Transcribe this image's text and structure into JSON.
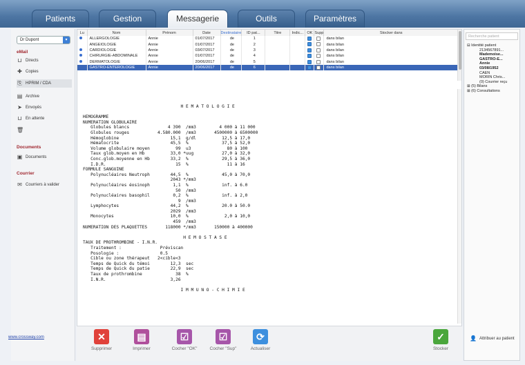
{
  "tabs": [
    "Patients",
    "Gestion",
    "Messagerie",
    "Outils",
    "Paramètres"
  ],
  "sidebar": {
    "doctor": "Dr Dupont",
    "email_section": "eMail",
    "items": [
      {
        "label": "Directs",
        "icon": "inbox-icon"
      },
      {
        "label": "Copies",
        "icon": "plus-icon"
      },
      {
        "label": "HPRIM / CDA",
        "icon": "document-icon"
      },
      {
        "label": "Archive",
        "icon": "archive-icon"
      },
      {
        "label": "Envoyés",
        "icon": "send-icon"
      },
      {
        "label": "En attente",
        "icon": "outbox-icon"
      },
      {
        "label": "",
        "icon": "trash-icon"
      }
    ],
    "documents_section": "Documents",
    "documents_item": "Documents",
    "courrier_section": "Courrier",
    "courrier_item": "Courriers à valider",
    "website": "www.crossway.com"
  },
  "table": {
    "headers": [
      "Lu",
      "Nom",
      "Prénom",
      "Date",
      "Destinataire",
      "ID pat...",
      "Titre",
      "Indic...",
      "OK",
      "Supp",
      "Stocker dans"
    ],
    "rows": [
      {
        "nom": "ALLERGOLOGIE",
        "prenom": "Annie",
        "date": "01/07/2017",
        "dest": "de",
        "id": "1",
        "ok": true,
        "supp": false,
        "stock": "dans bilan",
        "dot": true
      },
      {
        "nom": "ANGEIOLOGIE",
        "prenom": "Annie",
        "date": "01/07/2017",
        "dest": "de",
        "id": "2",
        "ok": true,
        "supp": false,
        "stock": "dans bilan",
        "dot": false
      },
      {
        "nom": "CARDIOLOGIE",
        "prenom": "Annie",
        "date": "03/07/2017",
        "dest": "de",
        "id": "3",
        "ok": true,
        "supp": false,
        "stock": "dans bilan",
        "dot": true
      },
      {
        "nom": "CHIRURGIE-ABDOMINALE",
        "prenom": "Annie",
        "date": "01/07/2017",
        "dest": "de",
        "id": "4",
        "ok": true,
        "supp": false,
        "stock": "dans bilan",
        "dot": true
      },
      {
        "nom": "DERMATOLOGIE",
        "prenom": "Annie",
        "date": "20/06/2017",
        "dest": "de",
        "id": "5",
        "ok": true,
        "supp": false,
        "stock": "dans bilan",
        "dot": true
      },
      {
        "nom": "GASTRO-ENTEROLOGIE",
        "prenom": "Annie",
        "date": "20/06/2017",
        "dest": "de",
        "id": "6",
        "ok": true,
        "supp": false,
        "stock": "dans bilan",
        "dot": false
      }
    ]
  },
  "report": "                                      H E M A T O L O G I E\n\nHEMOGRAMME\nNUMERATION GLOBULAIRE\n   Globules blancs               4 390  /mm3         4 000 à 11 000\n   Globules rouges           4.580.000  /mm3       4500000 à 6500000\n   Hémoglobine                    15,1  g/dl          12,5 à 17,0\n   Hématocrite                    45,5  %             37,5 à 52,0\n   Volume globulaire moyen          99  u3              80 à 100\n   Taux glob.moyen en Hb          33,0 *uug           27,0 à 32,0\n   Conc.glob.moyenne en Hb        33,2  %             29,5 à 36,0\n   I.D.R.                           15  %               11 à 16\nFORMULE SANGUINE\n   Polynucléaires Neutroph        44,5  %             45,0 à 70,0\n                                  2043 */mm3\n   Polynucléaires éosinoph         1,1  %             inf. à 6.0\n                                    50  /mm3\n   Polynucléaires basophil         0,2  %             inf. à 2,0\n                                     9  /mm3\n   Lymphocytes                    44,2  %             20.0 à 50.0\n                                  2029  /mm3\n   Monocytes                      10,0  %              2,0 à 10,0\n                                   459  /mm3\nNUMERATION DES PLAQUETTES       118000 */mm3       150000 à 400000\n\n                                       H E M O S T A S E\nTAUX DE PROTHROMBINE - I.N.R.\n   Traitement :               Préviscan\n   Posologie :                0.5\n   Cible ou zone thérapeut   2<cible<3\n   Temps de Quick du témoi        12,3  sec\n   Temps de Quick du patie        22,9  sec\n   Taux de prothrombine             38  %\n   I.N.R.                         3,26\n\n                                      I M M U N O - C H I M I E",
  "right": {
    "search_placeholder": "Recherche patient",
    "tree": [
      {
        "text": "⊟ Identité patient",
        "cls": ""
      },
      {
        "text": "2134567891...",
        "cls": "ind"
      },
      {
        "text": "Mademoise...",
        "cls": "ind b"
      },
      {
        "text": "GASTRO-E...",
        "cls": "ind b"
      },
      {
        "text": "Annie",
        "cls": "ind b"
      },
      {
        "text": "03/08/1952",
        "cls": "ind b"
      },
      {
        "text": "CAEN",
        "cls": "ind"
      },
      {
        "text": "MORIN Chris...",
        "cls": "ind"
      },
      {
        "text": "(0) Courrier reçu",
        "cls": "ind"
      },
      {
        "text": "⊞ (5) Bilans",
        "cls": ""
      },
      {
        "text": "⊞ (6) Consultations",
        "cls": ""
      }
    ],
    "add_patient": "Attribuer au patient"
  },
  "toolbar": [
    {
      "label": "Supprimer",
      "icon": "delete-icon",
      "color": "#e0423b",
      "glyph": "✕"
    },
    {
      "label": "Imprimer",
      "icon": "print-icon",
      "color": "#b0509c",
      "glyph": "▤"
    },
    {
      "label": "Cocher \"OK\"",
      "icon": "check-ok-icon",
      "color": "#a656a9",
      "glyph": "☑"
    },
    {
      "label": "Cocher \"Sup\"",
      "icon": "check-sup-icon",
      "color": "#a656a9",
      "glyph": "☑"
    },
    {
      "label": "Actualiser",
      "icon": "refresh-icon",
      "color": "#3d8fde",
      "glyph": "⟳"
    }
  ],
  "stocker": {
    "label": "Stocker",
    "icon": "stocker-icon",
    "color": "#4aa63c",
    "glyph": "✓"
  }
}
